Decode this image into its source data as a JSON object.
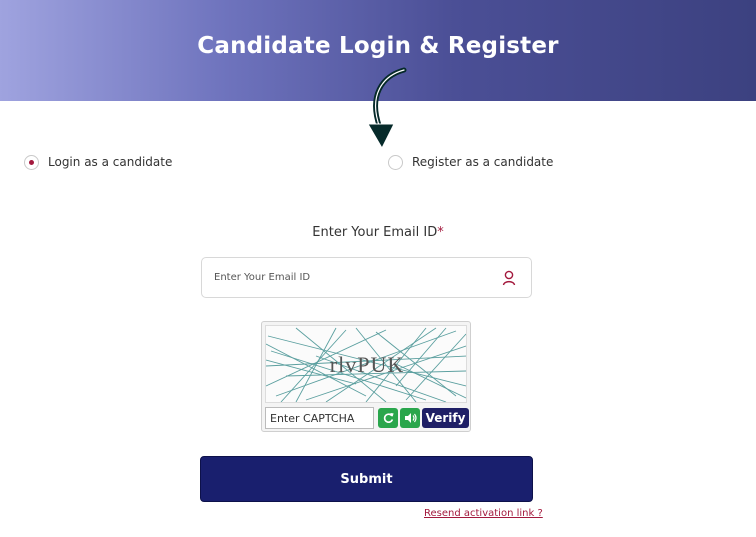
{
  "header": {
    "title": "Candidate Login & Register",
    "colors": {
      "start": "#9fa3df",
      "end": "#3c4180"
    }
  },
  "login_mode": {
    "options": [
      {
        "label": "Login as a candidate",
        "selected": true
      },
      {
        "label": "Register as a candidate",
        "selected": false
      }
    ]
  },
  "email": {
    "label": "Enter Your Email ID",
    "required_mark": "*",
    "placeholder": "Enter Your Email ID",
    "icon": "user-icon"
  },
  "captcha": {
    "code": "rlvPUK",
    "placeholder": "Enter CAPTCHA",
    "refresh_icon": "refresh-icon",
    "audio_icon": "speaker-icon",
    "verify_label": "Verify"
  },
  "form": {
    "submit_label": "Submit",
    "resend_link": "Resend activation link ?"
  },
  "colors": {
    "primary": "#191f6e",
    "accent": "#a3193d",
    "captcha_button": "#2aa64c"
  }
}
